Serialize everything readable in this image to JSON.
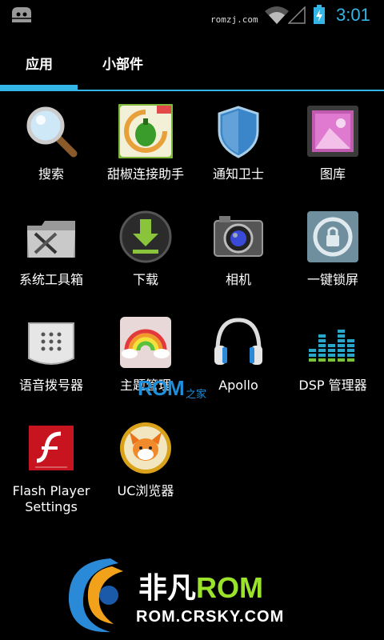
{
  "status_bar": {
    "carrier": "romzj.com",
    "time": "3:01",
    "icons": [
      "cyanogenmod-icon",
      "wifi-icon",
      "signal-icon",
      "battery-charging-icon"
    ]
  },
  "tabs": [
    {
      "label": "应用",
      "selected": true
    },
    {
      "label": "小部件",
      "selected": false
    }
  ],
  "accent_color": "#33b5e5",
  "apps": [
    {
      "label": "搜索",
      "icon": "search-icon"
    },
    {
      "label": "甜椒连接助手",
      "icon": "pepper-connect-icon"
    },
    {
      "label": "通知卫士",
      "icon": "shield-icon"
    },
    {
      "label": "图库",
      "icon": "gallery-icon"
    },
    {
      "label": "系统工具箱",
      "icon": "toolbox-icon"
    },
    {
      "label": "下载",
      "icon": "download-icon"
    },
    {
      "label": "相机",
      "icon": "camera-icon"
    },
    {
      "label": "一键锁屏",
      "icon": "lock-icon"
    },
    {
      "label": "语音拨号器",
      "icon": "voice-dialer-icon"
    },
    {
      "label": "主题管理",
      "icon": "theme-manager-icon"
    },
    {
      "label": "Apollo",
      "icon": "headphones-icon"
    },
    {
      "label": "DSP 管理器",
      "icon": "equalizer-icon"
    },
    {
      "label": "Flash Player Settings",
      "icon": "flash-player-icon"
    },
    {
      "label": "UC浏览器",
      "icon": "uc-browser-icon"
    }
  ],
  "watermark": {
    "text": "ROM",
    "sub": "之家"
  },
  "footer_logo": {
    "brand_cn": "非凡",
    "brand_rom": "ROM",
    "url": "ROM.CRSKY.COM"
  }
}
